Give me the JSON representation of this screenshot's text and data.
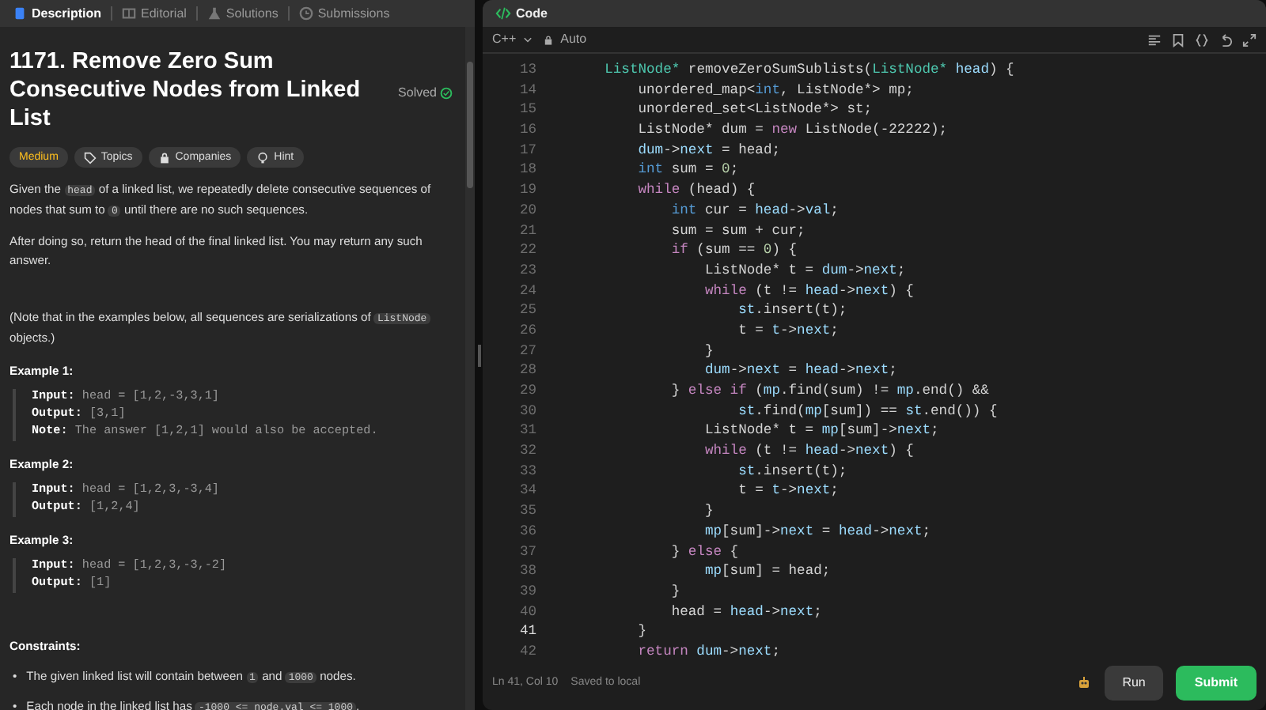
{
  "left_tabs": [
    {
      "label": "Description",
      "selected": true
    },
    {
      "label": "Editorial",
      "selected": false
    },
    {
      "label": "Solutions",
      "selected": false
    },
    {
      "label": "Submissions",
      "selected": false
    }
  ],
  "problem": {
    "title": "1171. Remove Zero Sum Consecutive Nodes from Linked List",
    "status": "Solved",
    "tags": [
      {
        "kind": "difficulty",
        "label": "Medium"
      },
      {
        "kind": "topics",
        "label": "Topics"
      },
      {
        "kind": "companies",
        "label": "Companies"
      },
      {
        "kind": "hint",
        "label": "Hint"
      }
    ],
    "paragraphs": [
      [
        {
          "kind": "text",
          "text": "Given the "
        },
        {
          "kind": "code",
          "text": "head"
        },
        {
          "kind": "text",
          "text": " of a linked list, we repeatedly delete consecutive sequences of nodes that sum to "
        },
        {
          "kind": "code",
          "text": "0"
        },
        {
          "kind": "text",
          "text": " until there are no such sequences."
        }
      ],
      [
        {
          "kind": "text",
          "text": "After doing so, return the head of the final linked list.  You may return any such answer."
        }
      ],
      [
        {
          "kind": "text",
          "text": "(Note that in the examples below, all sequences are serializations of "
        },
        {
          "kind": "code",
          "text": "ListNode"
        },
        {
          "kind": "text",
          "text": " objects.)"
        }
      ]
    ],
    "examples": [
      {
        "title": "Example 1:",
        "lines": [
          {
            "label": "Input:",
            "value": "head = [1,2,-3,3,1]"
          },
          {
            "label": "Output:",
            "value": "[3,1]"
          },
          {
            "label": "Note:",
            "value": "The answer [1,2,1] would also be accepted."
          }
        ]
      },
      {
        "title": "Example 2:",
        "lines": [
          {
            "label": "Input:",
            "value": "head = [1,2,3,-3,4]"
          },
          {
            "label": "Output:",
            "value": "[1,2,4]"
          }
        ]
      },
      {
        "title": "Example 3:",
        "lines": [
          {
            "label": "Input:",
            "value": "head = [1,2,3,-3,-2]"
          },
          {
            "label": "Output:",
            "value": "[1]"
          }
        ]
      }
    ],
    "constraints_title": "Constraints:",
    "constraints": [
      {
        "marker": "•",
        "parts": [
          {
            "kind": "text",
            "text": "The given linked list will contain between "
          },
          {
            "kind": "code",
            "text": "1"
          },
          {
            "kind": "text",
            "text": " and "
          },
          {
            "kind": "code",
            "text": "1000"
          },
          {
            "kind": "text",
            "text": " nodes."
          }
        ]
      },
      {
        "marker": "•",
        "parts": [
          {
            "kind": "text",
            "text": "Each node in the linked list has "
          },
          {
            "kind": "code",
            "text": "-1000 <= node.val <= 1000"
          },
          {
            "kind": "text",
            "text": "."
          }
        ]
      }
    ]
  },
  "code_panel": {
    "title": "Code",
    "language": "C++",
    "mode": "Auto",
    "lines": [
      {
        "number": "13",
        "current": false,
        "tokens": [
          {
            "kind": "type",
            "text": "    ListNode*"
          },
          {
            "kind": "plain",
            "text": " removeZeroSumSublists("
          },
          {
            "kind": "type",
            "text": "ListNode*"
          },
          {
            "kind": "var",
            "text": " head"
          },
          {
            "kind": "plain",
            "text": ") {"
          }
        ]
      },
      {
        "number": "14",
        "current": false,
        "tokens": [
          {
            "kind": "plain",
            "text": "        unordered_map<"
          },
          {
            "kind": "builtin",
            "text": "int"
          },
          {
            "kind": "plain",
            "text": ", ListNode*> mp;"
          }
        ]
      },
      {
        "number": "15",
        "current": false,
        "tokens": [
          {
            "kind": "plain",
            "text": "        unordered_set<ListNode*> st;"
          }
        ]
      },
      {
        "number": "16",
        "current": false,
        "tokens": [
          {
            "kind": "plain",
            "text": "        ListNode* dum = "
          },
          {
            "kind": "keyword",
            "text": "new"
          },
          {
            "kind": "plain",
            "text": " ListNode(-22222);"
          }
        ]
      },
      {
        "number": "17",
        "current": false,
        "tokens": [
          {
            "kind": "var",
            "text": "        dum"
          },
          {
            "kind": "plain",
            "text": "->"
          },
          {
            "kind": "var",
            "text": "next"
          },
          {
            "kind": "plain",
            "text": " = head;"
          }
        ]
      },
      {
        "number": "18",
        "current": false,
        "tokens": [
          {
            "kind": "builtin",
            "text": "        int"
          },
          {
            "kind": "plain",
            "text": " sum = "
          },
          {
            "kind": "number",
            "text": "0"
          },
          {
            "kind": "plain",
            "text": ";"
          }
        ]
      },
      {
        "number": "19",
        "current": false,
        "tokens": [
          {
            "kind": "keyword",
            "text": "        while"
          },
          {
            "kind": "plain",
            "text": " (head) {"
          }
        ]
      },
      {
        "number": "20",
        "current": false,
        "tokens": [
          {
            "kind": "builtin",
            "text": "            int"
          },
          {
            "kind": "plain",
            "text": " cur = "
          },
          {
            "kind": "var",
            "text": "head"
          },
          {
            "kind": "plain",
            "text": "->"
          },
          {
            "kind": "var",
            "text": "val"
          },
          {
            "kind": "plain",
            "text": ";"
          }
        ]
      },
      {
        "number": "21",
        "current": false,
        "tokens": [
          {
            "kind": "plain",
            "text": "            sum = sum + cur;"
          }
        ]
      },
      {
        "number": "22",
        "current": false,
        "tokens": [
          {
            "kind": "keyword",
            "text": "            if"
          },
          {
            "kind": "plain",
            "text": " (sum == "
          },
          {
            "kind": "number",
            "text": "0"
          },
          {
            "kind": "plain",
            "text": ") {"
          }
        ]
      },
      {
        "number": "23",
        "current": false,
        "tokens": [
          {
            "kind": "plain",
            "text": "                ListNode* t = "
          },
          {
            "kind": "var",
            "text": "dum"
          },
          {
            "kind": "plain",
            "text": "->"
          },
          {
            "kind": "var",
            "text": "next"
          },
          {
            "kind": "plain",
            "text": ";"
          }
        ]
      },
      {
        "number": "24",
        "current": false,
        "tokens": [
          {
            "kind": "keyword",
            "text": "                while"
          },
          {
            "kind": "plain",
            "text": " (t != "
          },
          {
            "kind": "var",
            "text": "head"
          },
          {
            "kind": "plain",
            "text": "->"
          },
          {
            "kind": "var",
            "text": "next"
          },
          {
            "kind": "plain",
            "text": ") {"
          }
        ]
      },
      {
        "number": "25",
        "current": false,
        "tokens": [
          {
            "kind": "var",
            "text": "                    st"
          },
          {
            "kind": "plain",
            "text": ".insert(t);"
          }
        ]
      },
      {
        "number": "26",
        "current": false,
        "tokens": [
          {
            "kind": "plain",
            "text": "                    t = "
          },
          {
            "kind": "var",
            "text": "t"
          },
          {
            "kind": "plain",
            "text": "->"
          },
          {
            "kind": "var",
            "text": "next"
          },
          {
            "kind": "plain",
            "text": ";"
          }
        ]
      },
      {
        "number": "27",
        "current": false,
        "tokens": [
          {
            "kind": "plain",
            "text": "                }"
          }
        ]
      },
      {
        "number": "28",
        "current": false,
        "tokens": [
          {
            "kind": "var",
            "text": "                dum"
          },
          {
            "kind": "plain",
            "text": "->"
          },
          {
            "kind": "var",
            "text": "next"
          },
          {
            "kind": "plain",
            "text": " = "
          },
          {
            "kind": "var",
            "text": "head"
          },
          {
            "kind": "plain",
            "text": "->"
          },
          {
            "kind": "var",
            "text": "next"
          },
          {
            "kind": "plain",
            "text": ";"
          }
        ]
      },
      {
        "number": "29",
        "current": false,
        "tokens": [
          {
            "kind": "plain",
            "text": "            } "
          },
          {
            "kind": "keyword",
            "text": "else if"
          },
          {
            "kind": "plain",
            "text": " ("
          },
          {
            "kind": "var",
            "text": "mp"
          },
          {
            "kind": "plain",
            "text": ".find(sum) != "
          },
          {
            "kind": "var",
            "text": "mp"
          },
          {
            "kind": "plain",
            "text": ".end() &&"
          }
        ]
      },
      {
        "number": "30",
        "current": false,
        "tokens": [
          {
            "kind": "var",
            "text": "                    st"
          },
          {
            "kind": "plain",
            "text": ".find("
          },
          {
            "kind": "var",
            "text": "mp"
          },
          {
            "kind": "plain",
            "text": "[sum]) == "
          },
          {
            "kind": "var",
            "text": "st"
          },
          {
            "kind": "plain",
            "text": ".end()) {"
          }
        ]
      },
      {
        "number": "31",
        "current": false,
        "tokens": [
          {
            "kind": "plain",
            "text": "                ListNode* t = "
          },
          {
            "kind": "var",
            "text": "mp"
          },
          {
            "kind": "plain",
            "text": "[sum]->"
          },
          {
            "kind": "var",
            "text": "next"
          },
          {
            "kind": "plain",
            "text": ";"
          }
        ]
      },
      {
        "number": "32",
        "current": false,
        "tokens": [
          {
            "kind": "keyword",
            "text": "                while"
          },
          {
            "kind": "plain",
            "text": " (t != "
          },
          {
            "kind": "var",
            "text": "head"
          },
          {
            "kind": "plain",
            "text": "->"
          },
          {
            "kind": "var",
            "text": "next"
          },
          {
            "kind": "plain",
            "text": ") {"
          }
        ]
      },
      {
        "number": "33",
        "current": false,
        "tokens": [
          {
            "kind": "var",
            "text": "                    st"
          },
          {
            "kind": "plain",
            "text": ".insert(t);"
          }
        ]
      },
      {
        "number": "34",
        "current": false,
        "tokens": [
          {
            "kind": "plain",
            "text": "                    t = "
          },
          {
            "kind": "var",
            "text": "t"
          },
          {
            "kind": "plain",
            "text": "->"
          },
          {
            "kind": "var",
            "text": "next"
          },
          {
            "kind": "plain",
            "text": ";"
          }
        ]
      },
      {
        "number": "35",
        "current": false,
        "tokens": [
          {
            "kind": "plain",
            "text": "                }"
          }
        ]
      },
      {
        "number": "36",
        "current": false,
        "tokens": [
          {
            "kind": "var",
            "text": "                mp"
          },
          {
            "kind": "plain",
            "text": "[sum]->"
          },
          {
            "kind": "var",
            "text": "next"
          },
          {
            "kind": "plain",
            "text": " = "
          },
          {
            "kind": "var",
            "text": "head"
          },
          {
            "kind": "plain",
            "text": "->"
          },
          {
            "kind": "var",
            "text": "next"
          },
          {
            "kind": "plain",
            "text": ";"
          }
        ]
      },
      {
        "number": "37",
        "current": false,
        "tokens": [
          {
            "kind": "plain",
            "text": "            } "
          },
          {
            "kind": "keyword",
            "text": "else"
          },
          {
            "kind": "plain",
            "text": " {"
          }
        ]
      },
      {
        "number": "38",
        "current": false,
        "tokens": [
          {
            "kind": "var",
            "text": "                mp"
          },
          {
            "kind": "plain",
            "text": "[sum] = head;"
          }
        ]
      },
      {
        "number": "39",
        "current": false,
        "tokens": [
          {
            "kind": "plain",
            "text": "            }"
          }
        ]
      },
      {
        "number": "40",
        "current": false,
        "tokens": [
          {
            "kind": "plain",
            "text": "            head = "
          },
          {
            "kind": "var",
            "text": "head"
          },
          {
            "kind": "plain",
            "text": "->"
          },
          {
            "kind": "var",
            "text": "next"
          },
          {
            "kind": "plain",
            "text": ";"
          }
        ]
      },
      {
        "number": "41",
        "current": true,
        "tokens": [
          {
            "kind": "plain",
            "text": "        }"
          }
        ]
      },
      {
        "number": "42",
        "current": false,
        "tokens": [
          {
            "kind": "keyword",
            "text": "        return"
          },
          {
            "kind": "var",
            "text": " dum"
          },
          {
            "kind": "plain",
            "text": "->"
          },
          {
            "kind": "var",
            "text": "next"
          },
          {
            "kind": "plain",
            "text": ";"
          }
        ]
      }
    ],
    "cursor": "Ln 41, Col 10",
    "saved": "Saved to local",
    "run": "Run",
    "submit": "Submit"
  }
}
